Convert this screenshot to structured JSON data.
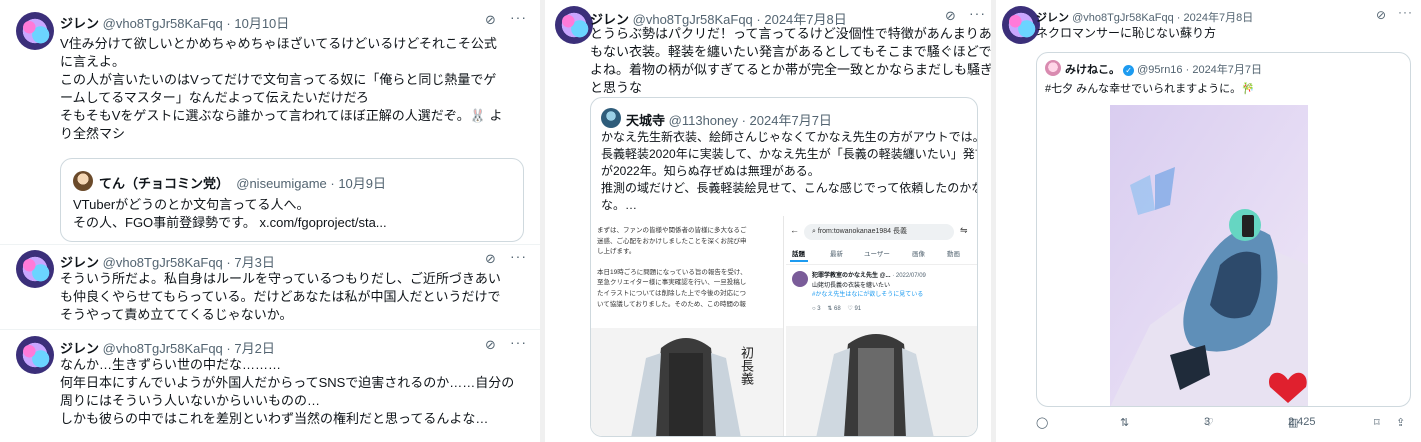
{
  "col1": {
    "t1": {
      "name": "ジレン",
      "handle": "@vho8TgJr58KaFqq",
      "date": "· 10月10日",
      "lines": [
        "V住み分けて欲しいとかめちゃめちゃほざいてるけどいるけどそれこそ公式",
        "に言えよ。",
        "この人が言いたいのはVってだけで文句言ってる奴に「俺らと同じ熱量でゲ",
        "ームしてるマスター」なんだよって伝えたいだけだろ",
        "そもそもVをゲストに選ぶなら誰かって言われてほぼ正解の人選だぞ。🐰 よ",
        "り全然マシ"
      ],
      "quote": {
        "name": "てん（チョコミン党）",
        "handle": "@niseumigame",
        "date": "· 10月9日",
        "lines": [
          "VTuberがどうのとか文句言ってる人へ。",
          "その人、FGO事前登録勢です。 x.com/fgoproject/sta..."
        ]
      }
    },
    "t2": {
      "name": "ジレン",
      "handle": "@vho8TgJr58KaFqq",
      "date": "· 7月3日",
      "lines": [
        "そういう所だよ。私自身はルールを守っているつもりだし、ご近所づきあい",
        "も仲良くやらせてもらっている。だけどあなたは私が中国人だというだけで",
        "そうやって責め立ててくるじゃないか。"
      ]
    },
    "t3": {
      "name": "ジレン",
      "handle": "@vho8TgJr58KaFqq",
      "date": "· 7月2日",
      "lines": [
        "なんか…生きずらい世の中だな………",
        "何年日本にすんでいようが外国人だからってSNSで迫害されるのか……自分の",
        "周りにはそういう人いないからいいものの…",
        "しかも彼らの中ではこれを差別といわず当然の権利だと思ってるんよな…"
      ]
    }
  },
  "col2": {
    "name": "ジレン",
    "handle": "@vho8TgJr58KaFqq",
    "date": "· 2024年7月8日",
    "lines": [
      "とうらぶ勢はパクリだ！って言ってるけど没個性で特徴があんまりある訳で",
      "もない衣装。軽装を纏いたい発言があるとしてもそこまで騒ぐほどでもない",
      "よね。着物の柄が似すぎてるとか帯が完全一致とかならまだしも騒ぎすぎだ",
      "と思うな"
    ],
    "quote": {
      "name": "天城寺",
      "handle": "@113honey",
      "date": "· 2024年7月7日",
      "lines": [
        "かなえ先生新衣装、絵師さんじゃなくてかなえ先生の方がアウトでは。",
        "長義軽装2020年に実装して、かなえ先生が「長義の軽装纏いたい」発言",
        "が2022年。知らぬ存ぜぬは無理がある。",
        "推測の域だけど、長義軽装絵見せて、こんな感じでって依頼したのかな",
        "な。…"
      ],
      "img_left": [
        "まずは、ファンの皆様や関係者の皆様に多大なるご",
        "迷惑、ご心配をおかけしましたことを深くお詫び申",
        "し上げます。",
        "",
        "本日19時ごろに問題になっている旨の報告を受け、",
        "至急クリエイター様に事実確認を行い、一旦投稿し",
        "たイラストについては削除した上で今後の対応につ",
        "いて協議しておりました。そのため、この時間の報"
      ],
      "vertical_text": "初長義",
      "search": {
        "query": "from:towanokanae1984 長義",
        "tabs": [
          "話題",
          "最新",
          "ユーザー",
          "画像",
          "動画"
        ],
        "tweet_name": "犯罪学教室のかなえ先生 @...",
        "tweet_date": "· 2022/07/09",
        "tweet_text": "山姥切長義の衣装を纏いたい",
        "tweet_tag": "#かなえ先生はなにが欲しそうに見ている",
        "counts": [
          "3",
          "68",
          "91"
        ]
      }
    }
  },
  "col3": {
    "name": "ジレン",
    "handle": "@vho8TgJr58KaFqq",
    "date": "· 2024年7月8日",
    "lines": [
      "ネクロマンサーに恥じない蘇り方"
    ],
    "quote": {
      "name": "みけねこ。",
      "handle": "@95rn16",
      "date": "· 2024年7月7日",
      "lines": [
        "#七夕 みんな幸せでいられますように。🎋"
      ]
    },
    "actions": {
      "reply": "",
      "retweet": "",
      "likes": "3",
      "views": "2,425"
    }
  },
  "colors": {
    "accent": "#1d9bf0",
    "border": "#cfd9de",
    "muted": "#536471"
  }
}
